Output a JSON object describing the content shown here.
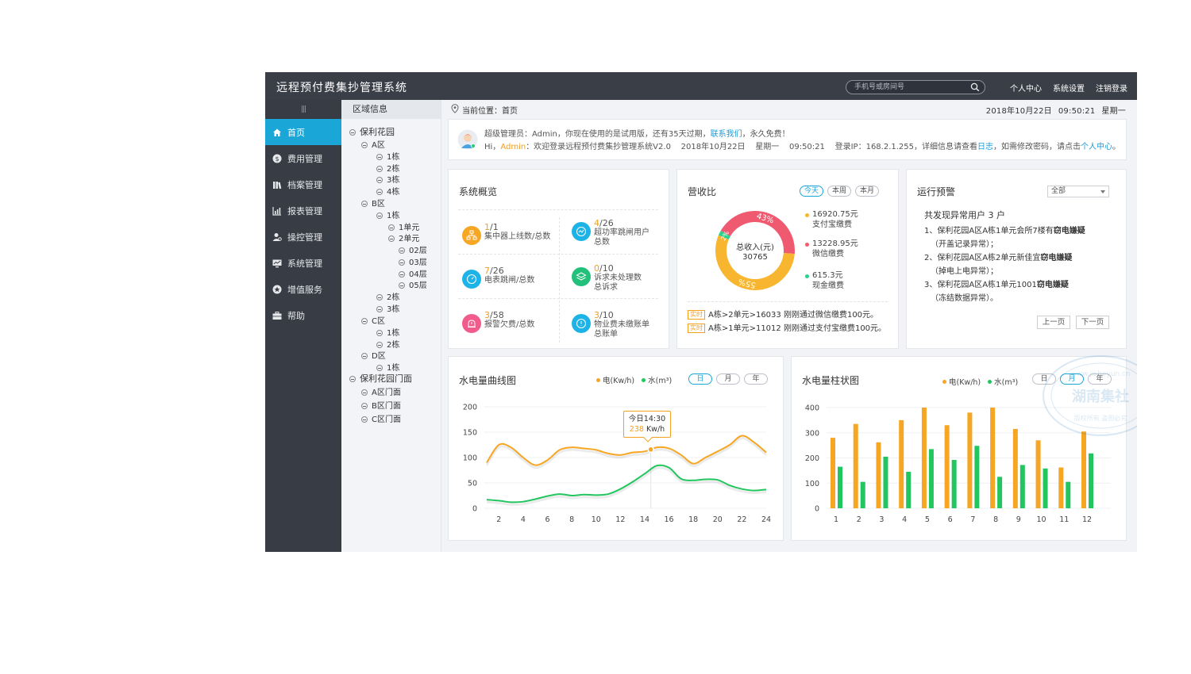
{
  "app": {
    "title": "远程预付费集抄管理系统"
  },
  "header": {
    "search_placeholder": "手机号或房间号",
    "links": [
      "个人中心",
      "系统设置",
      "注销登录"
    ]
  },
  "sidebar": {
    "handle": "|||",
    "items": [
      {
        "label": "首页",
        "icon": "home-icon",
        "active": true
      },
      {
        "label": "费用管理",
        "icon": "dollar-icon"
      },
      {
        "label": "档案管理",
        "icon": "archive-icon"
      },
      {
        "label": "报表管理",
        "icon": "report-icon"
      },
      {
        "label": "操控管理",
        "icon": "user-control-icon"
      },
      {
        "label": "系统管理",
        "icon": "monitor-icon"
      },
      {
        "label": "增值服务",
        "icon": "star-icon"
      },
      {
        "label": "帮助",
        "icon": "briefcase-icon"
      }
    ]
  },
  "tree": {
    "title": "区域信息",
    "nodes": [
      "保利花园",
      "A区",
      "1栋",
      "2栋",
      "3栋",
      "4栋",
      "B区",
      "1栋",
      "1单元",
      "2单元",
      "02层",
      "03层",
      "04层",
      "05层",
      "2栋",
      "3栋",
      "C区",
      "1栋",
      "2栋",
      "D区",
      "1栋",
      "保利花园门面",
      "A区门面",
      "B区门面",
      "C区门面"
    ]
  },
  "location": {
    "label": "当前位置：",
    "page": "首页",
    "date": "2018年10月22日",
    "time": "09:50:21",
    "weekday": "星期一"
  },
  "notice": {
    "line1_a": "超级管理员：Admin，你现在使用的是试用版，还有35天过期，",
    "line1_link": "联系我们",
    "line1_b": "，永久免费！",
    "line2_hi": "Hi，",
    "line2_user": "Admin",
    "line2_a": "：欢迎登录远程预付费集抄管理系统V2.0    2018年10月22日    星期一    09:50:21    登录IP：168.2.1.255，详细信息请查看",
    "line2_link1": "日志",
    "line2_b": "，如需修改密码，请点击",
    "line2_link2": "个人中心",
    "line2_c": "。"
  },
  "overview": {
    "title": "系统概览",
    "items": [
      {
        "num": "1",
        "total": "/1",
        "label": "集中器上线数/总数",
        "color": "#f6a623"
      },
      {
        "num": "4",
        "total": "/26",
        "label": "超功率跳闸用户\n总数",
        "color": "#1eb3e6"
      },
      {
        "num": "7",
        "total": "/26",
        "label": "电表跳闸/总数",
        "color": "#1eb3e6"
      },
      {
        "num": "0",
        "total": "/10",
        "label": "诉求未处理数\n总诉求",
        "color": "#22c07a"
      },
      {
        "num": "3",
        "total": "/58",
        "label": "报警欠费/总数",
        "color": "#f25c8d"
      },
      {
        "num": "3",
        "total": "/10",
        "label": "物业费未缴账单\n总账单",
        "color": "#1eb3e6"
      }
    ]
  },
  "revenue": {
    "title": "营收比",
    "tabs": [
      "今天",
      "本周",
      "本月"
    ],
    "center_label": "总收入(元)",
    "center_value": "30765",
    "slices": [
      {
        "name": "支付宝缴费",
        "amount": "16920.75元",
        "percent": 55,
        "label": "55%",
        "color": "#f8b530"
      },
      {
        "name": "微信缴费",
        "amount": "13228.95元",
        "percent": 43,
        "label": "43%",
        "color": "#f05a70"
      },
      {
        "name": "现金缴费",
        "amount": "615.3元",
        "percent": 2,
        "label": "2%",
        "color": "#2bd08a"
      }
    ],
    "realtime_tag": "实时",
    "realtime": [
      "A栋>2单元>16033 刚刚通过微信缴费100元。",
      "A栋>1单元>11012 刚刚通过支付宝缴费100元。"
    ]
  },
  "alerts": {
    "title": "运行预警",
    "filter": "全部",
    "summary": "共发现异常用户 3 户",
    "items": [
      {
        "a": "1、保利花园A区A栋1单元会所7楼有",
        "b": "窃电嫌疑",
        "c": "（开盖记录异常）；"
      },
      {
        "a": "2、保利花园A区A栋2单元新佳宜",
        "b": "窃电嫌疑",
        "c": "（掉电上电异常）；"
      },
      {
        "a": "3、保利花园A区A栋1单元1001",
        "b": "窃电嫌疑",
        "c": "（冻结数据异常）。"
      }
    ],
    "prev": "上一页",
    "next": "下一页"
  },
  "line_chart": {
    "title": "水电量曲线图",
    "legend": [
      "电(Kw/h)",
      "水(m³)"
    ],
    "tabs": [
      "日",
      "月",
      "年"
    ],
    "tooltip_time": "今日14:30",
    "tooltip_value": "238",
    "tooltip_unit": " Kw/h"
  },
  "bar_chart": {
    "title": "水电量柱状图",
    "legend": [
      "电(Kw/h)",
      "水(m³)"
    ],
    "tabs": [
      "日",
      "月",
      "年"
    ]
  },
  "watermark": {
    "text": "湖南集社",
    "url": "www.jisheyun.cn",
    "sub": "版权所有  盗图必究"
  },
  "chart_data": [
    {
      "type": "line",
      "title": "水电量曲线图",
      "x": [
        1,
        2,
        3,
        4,
        5,
        6,
        7,
        8,
        9,
        10,
        11,
        12,
        13,
        14,
        15,
        16,
        17,
        18,
        19,
        20,
        21,
        22,
        23,
        24
      ],
      "xticks": [
        2,
        4,
        6,
        8,
        10,
        12,
        14,
        16,
        18,
        20,
        22,
        24
      ],
      "yticks": [
        0,
        50,
        100,
        150,
        200
      ],
      "ylim": [
        0,
        200
      ],
      "series": [
        {
          "name": "电(Kw/h)",
          "color": "#f6a623",
          "values": [
            90,
            125,
            120,
            100,
            85,
            95,
            115,
            120,
            118,
            115,
            108,
            105,
            110,
            112,
            120,
            118,
            105,
            88,
            100,
            112,
            125,
            143,
            130,
            110
          ]
        },
        {
          "name": "水(m³)",
          "color": "#22c55e",
          "values": [
            17,
            15,
            12,
            13,
            18,
            24,
            28,
            25,
            27,
            26,
            28,
            38,
            52,
            68,
            84,
            80,
            58,
            55,
            57,
            56,
            45,
            38,
            35,
            37
          ]
        }
      ]
    },
    {
      "type": "bar",
      "title": "水电量柱状图",
      "categories": [
        "1",
        "2",
        "3",
        "4",
        "5",
        "6",
        "7",
        "8",
        "9",
        "10",
        "11",
        "12"
      ],
      "yticks": [
        0,
        100,
        200,
        300,
        400
      ],
      "ylim": [
        0,
        400
      ],
      "series": [
        {
          "name": "电(Kw/h)",
          "color": "#f6a623",
          "values": [
            280,
            335,
            262,
            350,
            400,
            330,
            380,
            400,
            315,
            270,
            162,
            305
          ]
        },
        {
          "name": "水(m³)",
          "color": "#22c55e",
          "values": [
            165,
            105,
            205,
            145,
            235,
            192,
            248,
            125,
            172,
            158,
            105,
            218
          ]
        }
      ]
    }
  ]
}
